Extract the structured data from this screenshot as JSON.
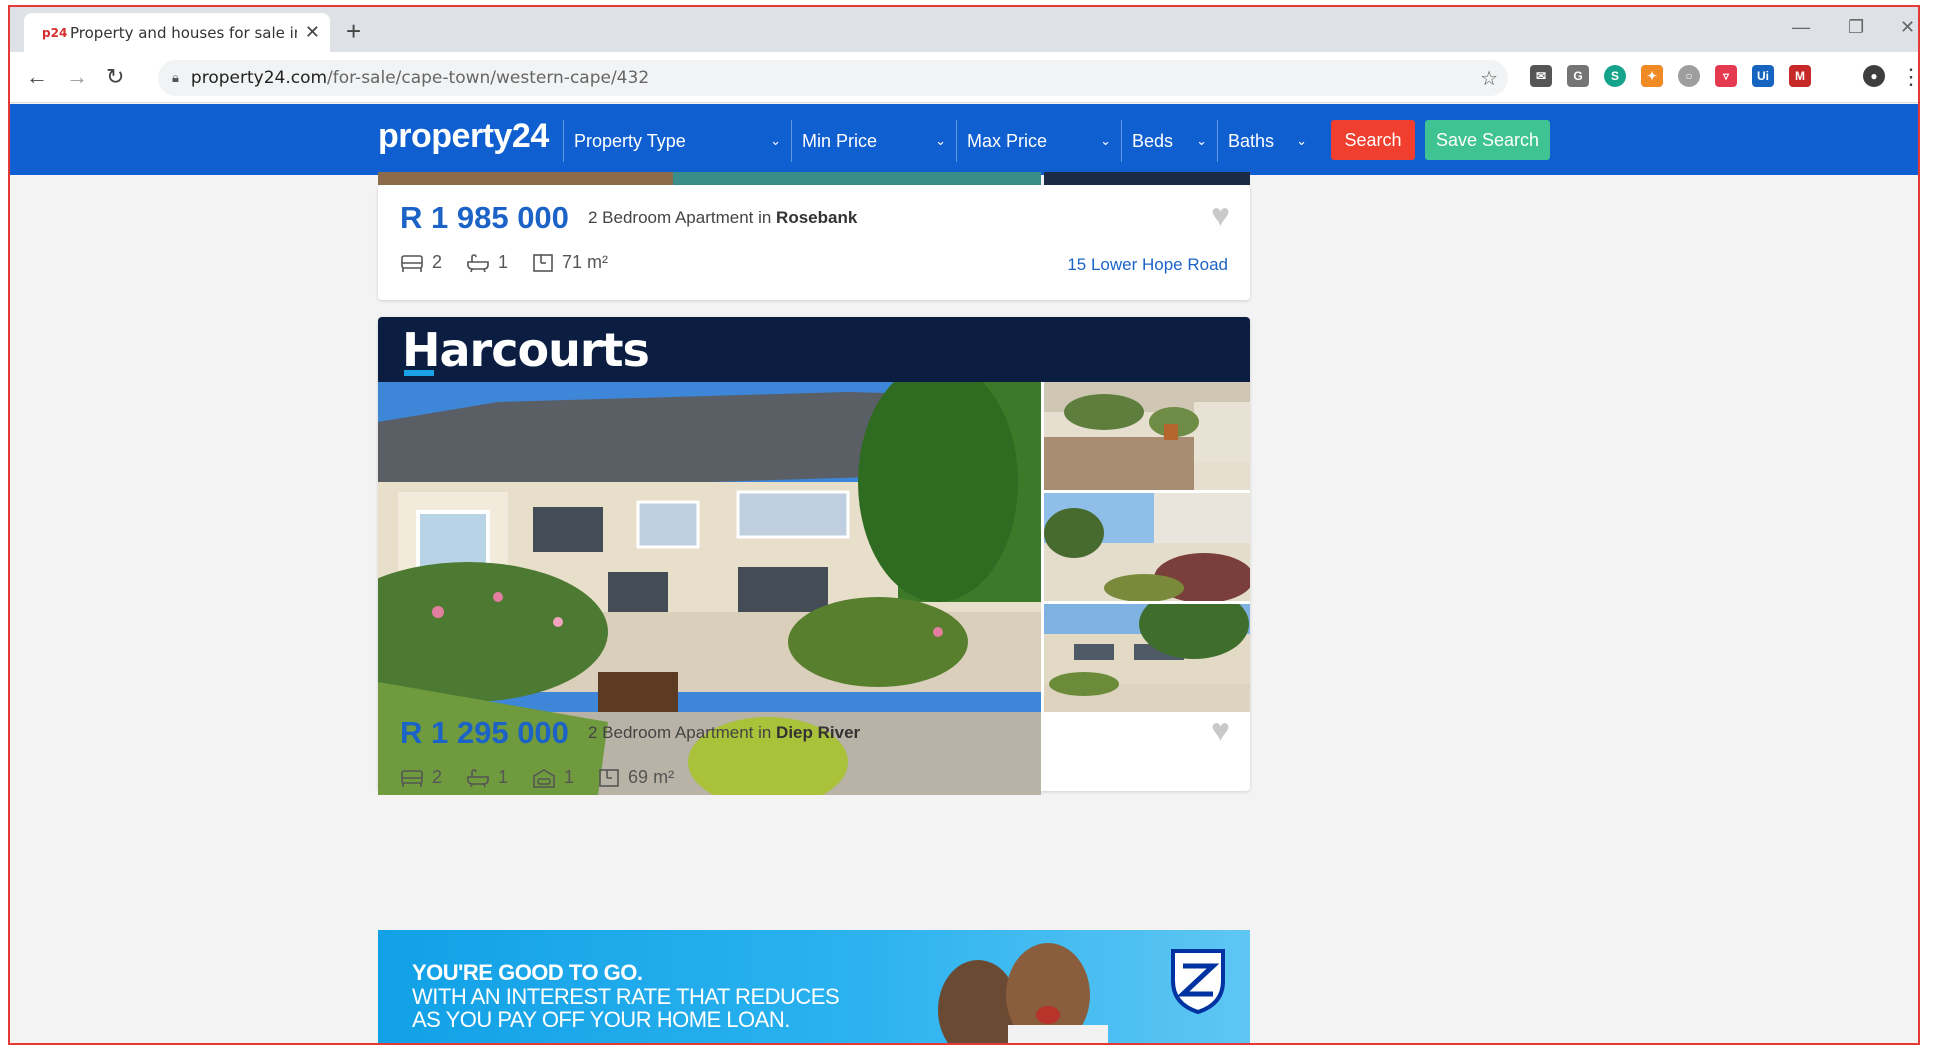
{
  "browser": {
    "tab_favicon": "p24",
    "tab_title": "Property and houses for sale in C",
    "tab_close": "✕",
    "new_tab": "+",
    "url_domain": "property24.com",
    "url_path": "/for-sale/cape-town/western-cape/432",
    "window_controls": [
      "—",
      "❐",
      "✕"
    ]
  },
  "header": {
    "logo": "property24",
    "filters": [
      {
        "label": "Property Type"
      },
      {
        "label": "Min Price"
      },
      {
        "label": "Max Price"
      },
      {
        "label": "Beds"
      },
      {
        "label": "Baths"
      }
    ],
    "search_label": "Search",
    "save_search_label": "Save Search",
    "colors": {
      "brand_blue": "#0f5fd1",
      "search_red": "#f03e2f",
      "save_green": "#3fc393"
    }
  },
  "listings": [
    {
      "price": "R 1 985 000",
      "type": "2 Bedroom Apartment in ",
      "suburb": "Rosebank",
      "beds": "2",
      "baths": "1",
      "size": "71 m²",
      "address": "15 Lower Hope Road"
    },
    {
      "agency": "Harcourts",
      "price": "R 1 295 000",
      "type": "2 Bedroom Apartment in ",
      "suburb": "Diep River",
      "beds": "2",
      "baths": "1",
      "parking": "1",
      "size": "69 m²"
    }
  ],
  "ad": {
    "line1": "YOU'RE GOOD TO GO.",
    "line2": "WITH AN INTEREST RATE THAT REDUCES",
    "line3": "AS YOU PAY OFF YOUR HOME LOAN."
  }
}
